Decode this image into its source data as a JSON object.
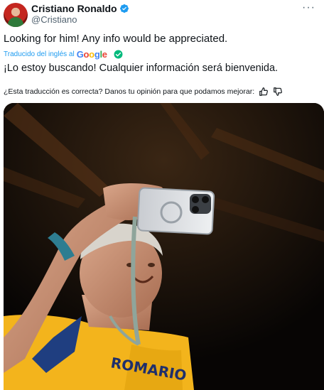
{
  "user": {
    "name": "Cristiano Ronaldo",
    "handle": "@Cristiano",
    "verified": true
  },
  "menu_icon": "more-horizontal-icon",
  "tweet": {
    "text": "Looking for him! Any info would be appreciated."
  },
  "translation": {
    "source_label": "Traducido del inglés al",
    "provider": [
      "G",
      "o",
      "o",
      "g",
      "l",
      "e"
    ],
    "text": "¡Lo estoy buscando! Cualquier información será bienvenida."
  },
  "feedback": {
    "question": "¿Esta traducción es correcta? Danos tu opinión para que podamos mejorar:"
  },
  "colors": {
    "accent": "#1d9bf0",
    "secondary_text": "#536471",
    "verified_green": "#00ba7c"
  }
}
